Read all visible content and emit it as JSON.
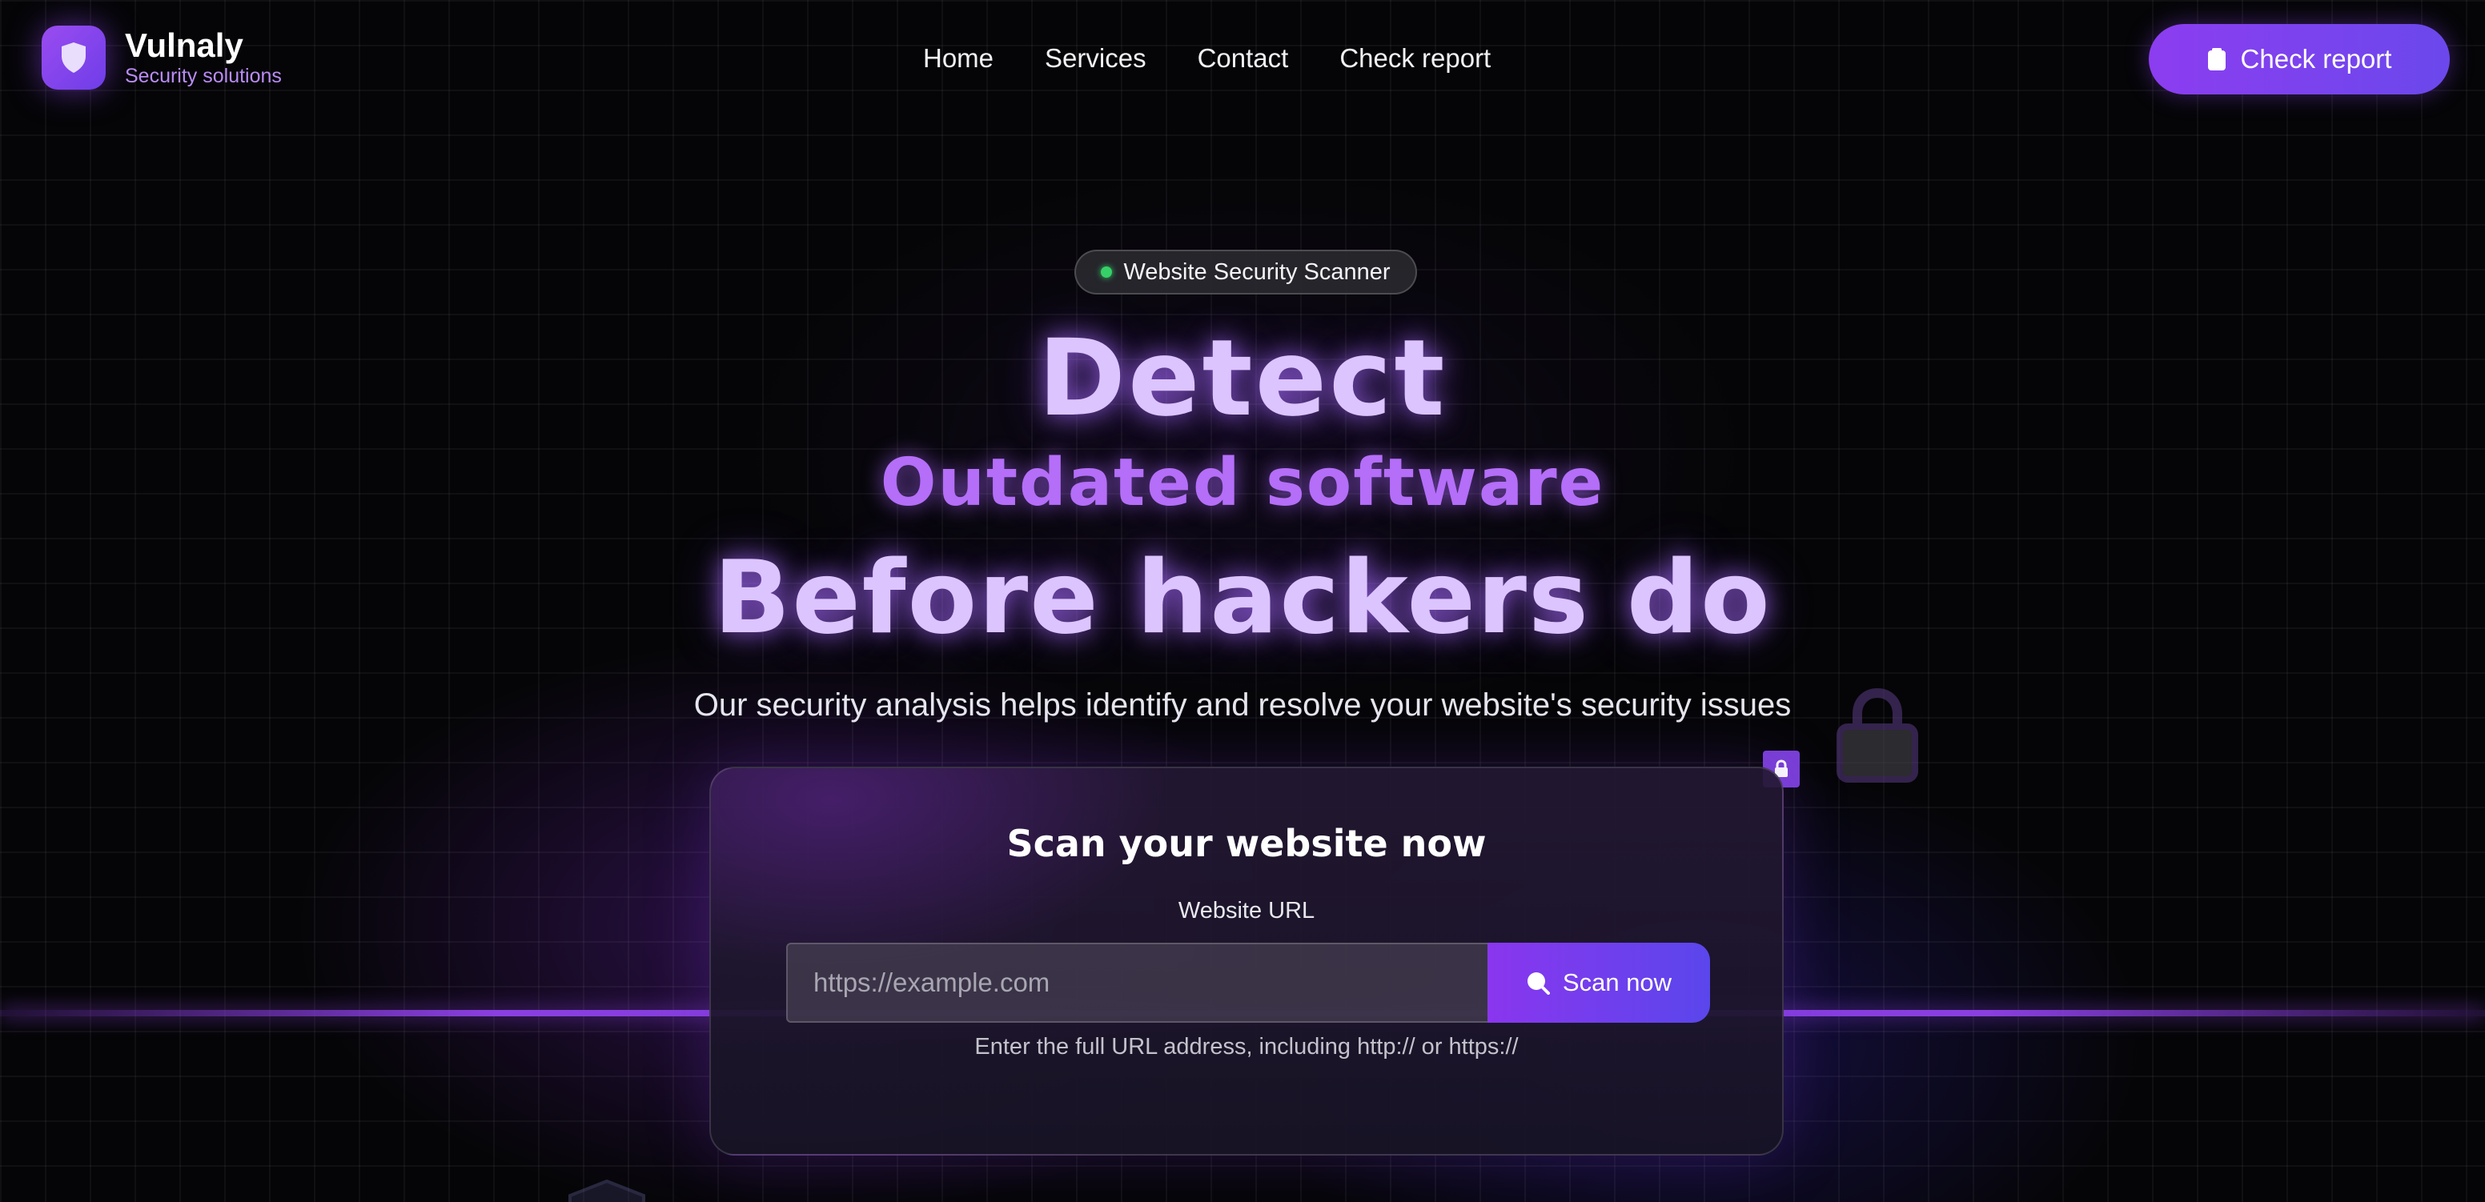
{
  "brand": {
    "name": "Vulnaly",
    "tagline": "Security solutions",
    "logo_icon": "shield-icon"
  },
  "nav": {
    "items": [
      {
        "label": "Home"
      },
      {
        "label": "Services"
      },
      {
        "label": "Contact"
      },
      {
        "label": "Check report"
      }
    ]
  },
  "header_cta": {
    "label": "Check report",
    "icon": "clipboard-icon"
  },
  "hero": {
    "badge": "Website Security Scanner",
    "badge_status_color": "#36d068",
    "line1": "Detect",
    "line2": "Outdated software",
    "line3": "Before hackers do",
    "subtitle": "Our security analysis helps identify and resolve your website's security issues"
  },
  "scan_card": {
    "title": "Scan your website now",
    "field_label": "Website URL",
    "placeholder": "https://example.com",
    "button_label": "Scan now",
    "button_icon": "search-icon",
    "hint": "Enter the full URL address, including http:// or https://"
  },
  "colors": {
    "background": "#050507",
    "accent": "#8c3df0",
    "accent_secondary": "#6b48ec",
    "heading_glow": "#dcc4ff",
    "heading_highlight": "#b46ef8"
  }
}
